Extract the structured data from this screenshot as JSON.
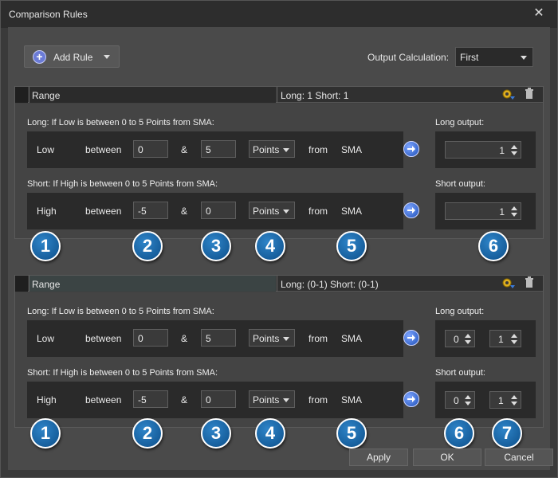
{
  "window": {
    "title": "Comparison Rules"
  },
  "toolbar": {
    "add_rule_label": "Add Rule",
    "output_calc_label": "Output Calculation:",
    "output_calc_value": "First"
  },
  "rules": [
    {
      "name": "Range",
      "summary": "Long: 1 Short: 1",
      "long": {
        "label": "Long: If Low is  between 0 to 5 Points from SMA:",
        "field": "Low",
        "op": "between",
        "from": "0",
        "and": "&",
        "to": "5",
        "unit": "Points",
        "from_word": "from",
        "indicator": "SMA",
        "output_label": "Long output:",
        "output": "1"
      },
      "short": {
        "label": "Short: If High is  between 0 to 5 Points from SMA:",
        "field": "High",
        "op": "between",
        "from": "-5",
        "and": "&",
        "to": "0",
        "unit": "Points",
        "from_word": "from",
        "indicator": "SMA",
        "output_label": "Short output:",
        "output": "1"
      }
    },
    {
      "name": "Range",
      "summary": "Long: (0-1) Short: (0-1)",
      "long": {
        "label": "Long: If Low is  between 0 to 5 Points from SMA:",
        "field": "Low",
        "op": "between",
        "from": "0",
        "and": "&",
        "to": "5",
        "unit": "Points",
        "from_word": "from",
        "indicator": "SMA",
        "output_label": "Long output:",
        "output_min": "0",
        "output_max": "1"
      },
      "short": {
        "label": "Short: If High is  between 0 to 5 Points from SMA:",
        "field": "High",
        "op": "between",
        "from": "-5",
        "and": "&",
        "to": "0",
        "unit": "Points",
        "from_word": "from",
        "indicator": "SMA",
        "output_label": "Short output:",
        "output_min": "0",
        "output_max": "1"
      }
    }
  ],
  "badges_top": [
    "1",
    "2",
    "3",
    "4",
    "5",
    "6"
  ],
  "badges_bottom": [
    "1",
    "2",
    "3",
    "4",
    "5",
    "6",
    "7"
  ],
  "buttons": {
    "apply": "Apply",
    "ok": "OK",
    "cancel": "Cancel"
  },
  "colors": {
    "badge_blue": "#1565a8",
    "accent_plus": "#6b7bd6",
    "background": "#4a4a4a"
  },
  "icons": {
    "close": "close-icon",
    "plus": "plus-circle-icon",
    "settings": "gear-arrow-icon",
    "delete": "trash-icon",
    "arrow": "arrow-right-circle-icon"
  }
}
